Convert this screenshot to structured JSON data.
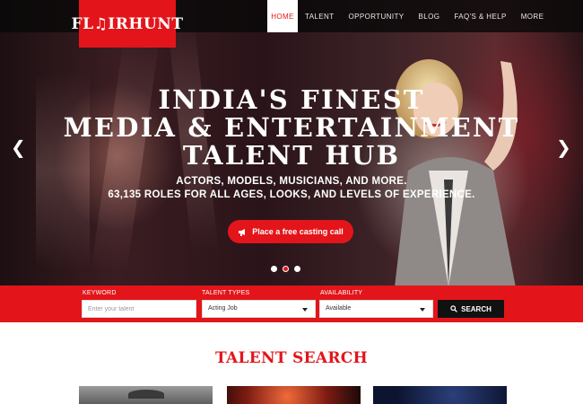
{
  "brand": {
    "logo_text": "FL♫IRHUNT",
    "accent": "#e3151a"
  },
  "nav": {
    "items": [
      {
        "label": "HOME",
        "active": true
      },
      {
        "label": "TALENT"
      },
      {
        "label": "OPPORTUNITY"
      },
      {
        "label": "BLOG"
      },
      {
        "label": "FAQ'S & HELP"
      },
      {
        "label": "MORE"
      }
    ]
  },
  "hero": {
    "headline": [
      "INDIA'S FINEST",
      "MEDIA & ENTERTAINMENT",
      "TALENT HUB"
    ],
    "subline": [
      "ACTORS, MODELS, MUSICIANS, AND MORE.",
      "63,135 ROLES FOR ALL AGES, LOOKS, AND LEVELS OF EXPERIENCE."
    ],
    "cta_label": "Place a free casting call",
    "cta_icon": "megaphone-icon",
    "prev_arrow": "❮",
    "next_arrow": "❯",
    "slides": {
      "count": 3,
      "active_index": 1
    }
  },
  "search": {
    "keyword_label": "KEYWORD",
    "keyword_placeholder": "Enter your talent",
    "talent_types_label": "TALENT TYPES",
    "talent_types_value": "Acting Job",
    "availability_label": "AVAILABILITY",
    "availability_value": "Available",
    "button_label": "SEARCH",
    "button_icon": "search-icon"
  },
  "talent_section": {
    "title": "TALENT SEARCH"
  }
}
